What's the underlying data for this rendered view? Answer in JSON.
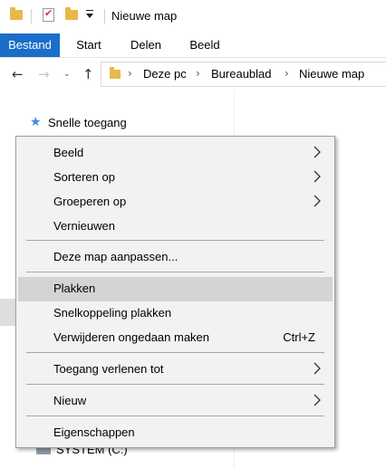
{
  "window": {
    "title": "Nieuwe map"
  },
  "ribbon": {
    "tabs": [
      {
        "label": "Bestand"
      },
      {
        "label": "Start"
      },
      {
        "label": "Delen"
      },
      {
        "label": "Beeld"
      }
    ]
  },
  "address_bar": {
    "crumbs": [
      "Deze pc",
      "Bureaublad",
      "Nieuwe map"
    ]
  },
  "nav_pane": {
    "quick_access": "Snelle toegang",
    "drive": "SYSTEM (C:)"
  },
  "context_menu": {
    "items": [
      {
        "label": "Beeld",
        "submenu": true
      },
      {
        "label": "Sorteren op",
        "submenu": true
      },
      {
        "label": "Groeperen op",
        "submenu": true
      },
      {
        "label": "Vernieuwen"
      },
      {
        "label": "Deze map aanpassen..."
      },
      {
        "label": "Plakken",
        "highlighted": true
      },
      {
        "label": "Snelkoppeling plakken"
      },
      {
        "label": "Verwijderen ongedaan maken",
        "shortcut": "Ctrl+Z"
      },
      {
        "label": "Toegang verlenen tot",
        "submenu": true
      },
      {
        "label": "Nieuw",
        "submenu": true
      },
      {
        "label": "Eigenschappen"
      }
    ]
  },
  "colors": {
    "file_tab": "#1a6dc8",
    "menu_background": "#f2f2f2",
    "menu_highlight": "#d4d4d4",
    "folder": "#e8b84a"
  }
}
